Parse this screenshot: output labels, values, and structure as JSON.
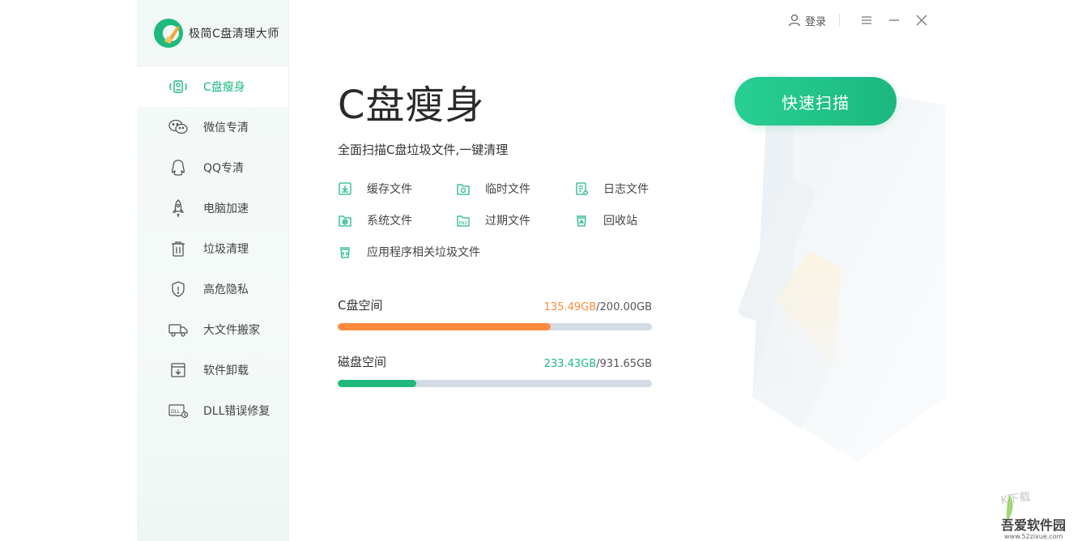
{
  "app": {
    "name": "极简C盘清理大师",
    "accent": "#1fb97f",
    "orange": "#ff8a3d"
  },
  "topbar": {
    "login_label": "登录"
  },
  "sidebar": {
    "items": [
      {
        "label": "C盘瘦身",
        "icon": "disk-slim-icon",
        "active": true
      },
      {
        "label": "微信专清",
        "icon": "wechat-icon",
        "active": false
      },
      {
        "label": "QQ专清",
        "icon": "qq-icon",
        "active": false
      },
      {
        "label": "电脑加速",
        "icon": "rocket-icon",
        "active": false
      },
      {
        "label": "垃圾清理",
        "icon": "trash-icon",
        "active": false
      },
      {
        "label": "高危隐私",
        "icon": "shield-icon",
        "active": false
      },
      {
        "label": "大文件搬家",
        "icon": "truck-icon",
        "active": false
      },
      {
        "label": "软件卸载",
        "icon": "uninstall-icon",
        "active": false
      },
      {
        "label": "DLL错误修复",
        "icon": "dll-icon",
        "active": false
      }
    ]
  },
  "main": {
    "title": "C盘瘦身",
    "subtitle": "全面扫描C盘垃圾文件,一键清理",
    "scan_button": "快速扫描",
    "features": [
      {
        "label": "缓存文件",
        "icon": "cache-file-icon"
      },
      {
        "label": "临时文件",
        "icon": "temp-file-icon"
      },
      {
        "label": "日志文件",
        "icon": "log-file-icon"
      },
      {
        "label": "系统文件",
        "icon": "system-file-icon"
      },
      {
        "label": "过期文件",
        "icon": "expired-file-icon"
      },
      {
        "label": "回收站",
        "icon": "recycle-bin-icon"
      },
      {
        "label": "应用程序相关垃圾文件",
        "icon": "app-junk-icon"
      }
    ],
    "spaces": [
      {
        "label": "C盘空间",
        "used": "135.49GB",
        "total": "/200.00GB",
        "fraction": 0.6775,
        "color": "#ff8a3d"
      },
      {
        "label": "磁盘空间",
        "used": "233.43GB",
        "total": "/931.65GB",
        "fraction": 0.2506,
        "color": "#1fb97f"
      }
    ]
  },
  "watermark": {
    "line1": "吾爱软件园",
    "line2": "www.52zixue.com"
  }
}
